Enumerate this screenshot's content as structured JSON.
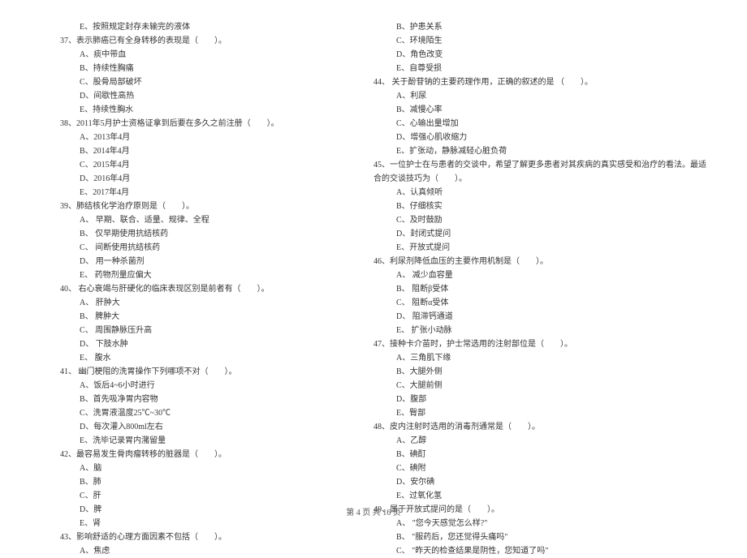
{
  "leftColumn": {
    "lines": [
      {
        "text": "E、按照规定封存未输完的液体",
        "indent": "indent-1"
      },
      {
        "text": "37、表示肺癌已有全身转移的表现是（　　）。",
        "indent": "indent-q"
      },
      {
        "text": "A、痰中带血",
        "indent": "indent-1"
      },
      {
        "text": "B、持续性胸痛",
        "indent": "indent-1"
      },
      {
        "text": "C、股骨局部破坏",
        "indent": "indent-1"
      },
      {
        "text": "D、间歇性高热",
        "indent": "indent-1"
      },
      {
        "text": "E、持续性胸水",
        "indent": "indent-1"
      },
      {
        "text": "38、2011年5月护士资格证拿到后要在多久之前注册（　　）。",
        "indent": "indent-q"
      },
      {
        "text": "A、2013年4月",
        "indent": "indent-1"
      },
      {
        "text": "B、2014年4月",
        "indent": "indent-1"
      },
      {
        "text": "C、2015年4月",
        "indent": "indent-1"
      },
      {
        "text": "D、2016年4月",
        "indent": "indent-1"
      },
      {
        "text": "E、2017年4月",
        "indent": "indent-1"
      },
      {
        "text": "39、肺结核化学治疗原则是（　　）。",
        "indent": "indent-q"
      },
      {
        "text": "A、 早期、联合、适量、规律、全程",
        "indent": "indent-1"
      },
      {
        "text": "B、 仅早期使用抗结核药",
        "indent": "indent-1"
      },
      {
        "text": "C、 间断使用抗结核药",
        "indent": "indent-1"
      },
      {
        "text": "D、 用一种杀菌剂",
        "indent": "indent-1"
      },
      {
        "text": "E、 药物剂量应偏大",
        "indent": "indent-1"
      },
      {
        "text": "40、 右心衰竭与肝硬化的临床表现区别是前者有（　　）。",
        "indent": "indent-q"
      },
      {
        "text": "A、 肝肿大",
        "indent": "indent-1"
      },
      {
        "text": "B、 脾肿大",
        "indent": "indent-1"
      },
      {
        "text": "C、 周围静脉压升高",
        "indent": "indent-1"
      },
      {
        "text": "D、 下肢水肿",
        "indent": "indent-1"
      },
      {
        "text": "E、 腹水",
        "indent": "indent-1"
      },
      {
        "text": "41、 幽门梗阻的洗胃操作下列哪项不对（　　）。",
        "indent": "indent-q"
      },
      {
        "text": "A、饭后4~6小时进行",
        "indent": "indent-1"
      },
      {
        "text": "B、首先吸净胃内容物",
        "indent": "indent-1"
      },
      {
        "text": "C、洗胃液温度25℃~30℃",
        "indent": "indent-1"
      },
      {
        "text": "D、每次灌入800ml左右",
        "indent": "indent-1"
      },
      {
        "text": "E、洗毕记录胃内潴留量",
        "indent": "indent-1"
      },
      {
        "text": "42、最容易发生骨肉瘤转移的脏器是（　　）。",
        "indent": "indent-q"
      },
      {
        "text": "A、脑",
        "indent": "indent-1"
      },
      {
        "text": "B、肺",
        "indent": "indent-1"
      },
      {
        "text": "C、肝",
        "indent": "indent-1"
      },
      {
        "text": "D、脾",
        "indent": "indent-1"
      },
      {
        "text": "E、肾",
        "indent": "indent-1"
      },
      {
        "text": "43、影响舒适的心理方面因素不包括（　　）。",
        "indent": "indent-q"
      },
      {
        "text": "A、焦虑",
        "indent": "indent-1"
      }
    ]
  },
  "rightColumn": {
    "lines": [
      {
        "text": "B、护患关系",
        "indent": "indent-1"
      },
      {
        "text": "C、环境陌生",
        "indent": "indent-1"
      },
      {
        "text": "D、角色改变",
        "indent": "indent-1"
      },
      {
        "text": "E、自尊受损",
        "indent": "indent-1"
      },
      {
        "text": "44、 关于酚苷钠的主要药理作用，正确的叙述的是 （　　）。",
        "indent": "indent-q2"
      },
      {
        "text": "A、利尿",
        "indent": "indent-1"
      },
      {
        "text": "B、减慢心率",
        "indent": "indent-1"
      },
      {
        "text": "C、心输出量增加",
        "indent": "indent-1"
      },
      {
        "text": "D、增强心肌收缩力",
        "indent": "indent-1"
      },
      {
        "text": "E、扩张动，静脉减轻心脏负荷",
        "indent": "indent-1"
      },
      {
        "text": "45、一位护士在与患者的交谈中，希望了解更多患者对其疾病的真实感受和治疗的看法。最适",
        "indent": "indent-q2"
      },
      {
        "text": "合的交谈技巧为（　　）。",
        "indent": "indent-q2"
      },
      {
        "text": "A、认真倾听",
        "indent": "indent-1"
      },
      {
        "text": "B、仔细核实",
        "indent": "indent-1"
      },
      {
        "text": "C、及时鼓励",
        "indent": "indent-1"
      },
      {
        "text": "D、封闭式提问",
        "indent": "indent-1"
      },
      {
        "text": "E、开放式提问",
        "indent": "indent-1"
      },
      {
        "text": "46、利尿剂降低血压的主要作用机制是（　　）。",
        "indent": "indent-q2"
      },
      {
        "text": "A、 减少血容量",
        "indent": "indent-1"
      },
      {
        "text": "B、 阻断β受体",
        "indent": "indent-1"
      },
      {
        "text": "C、 阻断α受体",
        "indent": "indent-1"
      },
      {
        "text": "D、 阻滞钙通道",
        "indent": "indent-1"
      },
      {
        "text": "E、 扩张小动脉",
        "indent": "indent-1"
      },
      {
        "text": "47、接种卡介苗时，护士常选用的注射部位是（　　）。",
        "indent": "indent-q2"
      },
      {
        "text": "A、三角肌下缘",
        "indent": "indent-1"
      },
      {
        "text": "B、大腿外侧",
        "indent": "indent-1"
      },
      {
        "text": "C、大腿前侧",
        "indent": "indent-1"
      },
      {
        "text": "D、腹部",
        "indent": "indent-1"
      },
      {
        "text": "E、臀部",
        "indent": "indent-1"
      },
      {
        "text": "48、皮内注射时选用的消毒剂通常是（　　）。",
        "indent": "indent-q2"
      },
      {
        "text": "A、乙醇",
        "indent": "indent-1"
      },
      {
        "text": "B、碘酊",
        "indent": "indent-1"
      },
      {
        "text": "C、碘附",
        "indent": "indent-1"
      },
      {
        "text": "D、安尔碘",
        "indent": "indent-1"
      },
      {
        "text": "E、过氧化氢",
        "indent": "indent-1"
      },
      {
        "text": "49、属于开放式提问的是（　　）。",
        "indent": "indent-q2"
      },
      {
        "text": "A、 \"您今天感觉怎么样?\"",
        "indent": "indent-1"
      },
      {
        "text": "B、 \"服药后，您还觉得头痛吗\"",
        "indent": "indent-1"
      },
      {
        "text": "C、 \"昨天的检查结果是阴性，您知道了吗\"",
        "indent": "indent-1"
      }
    ]
  },
  "footer": {
    "text": "第 4 页 共 16 页"
  }
}
